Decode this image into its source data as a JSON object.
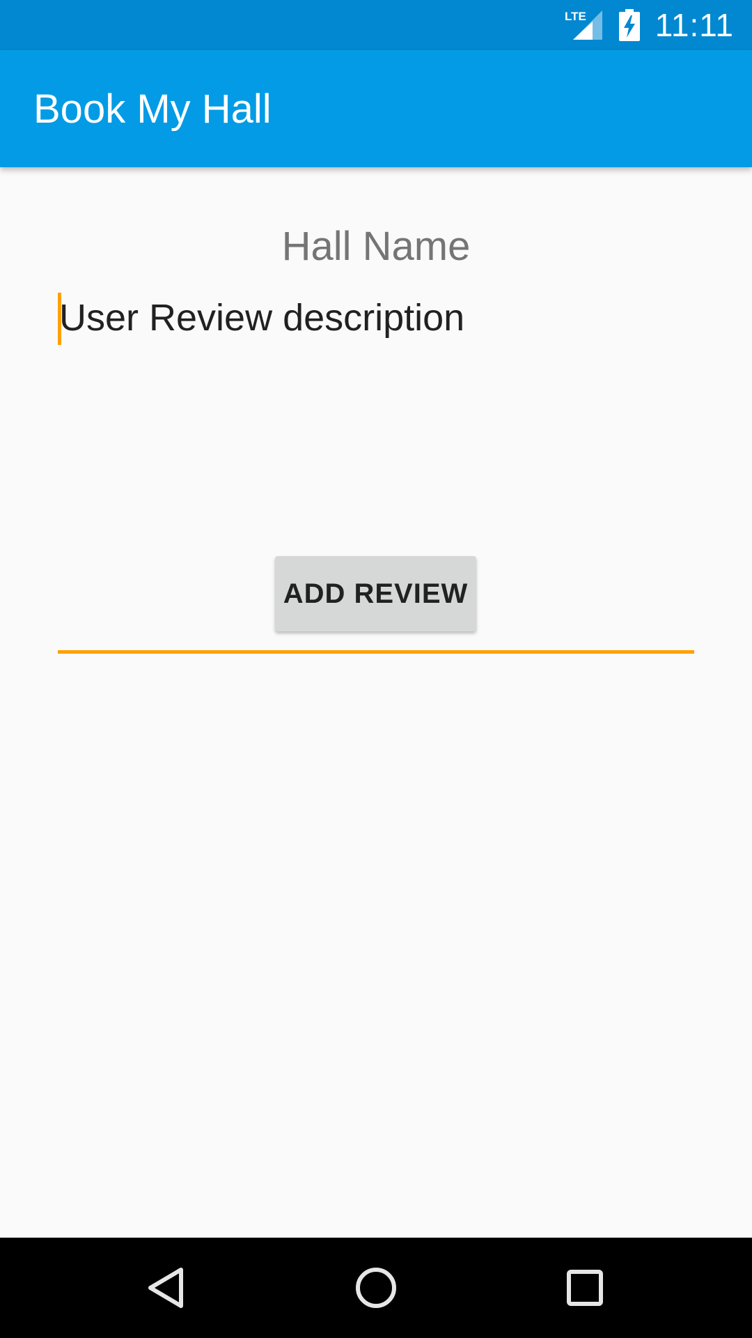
{
  "status_bar": {
    "time": "11:11",
    "network_icon": "lte-signal-icon",
    "network_label": "LTE",
    "battery_icon": "battery-charging-icon"
  },
  "app_bar": {
    "title": "Book My Hall"
  },
  "main": {
    "hall_name": "Hall Name",
    "review_input": {
      "value": "User Review description"
    },
    "add_review_label": "ADD REVIEW"
  },
  "nav_bar": {
    "back_icon": "back-icon",
    "home_icon": "home-icon",
    "recents_icon": "recents-icon"
  },
  "colors": {
    "status_bar": "#0288d1",
    "app_bar": "#039be5",
    "accent": "#ffa000",
    "background": "#fafafa",
    "button": "#d6d7d7"
  }
}
